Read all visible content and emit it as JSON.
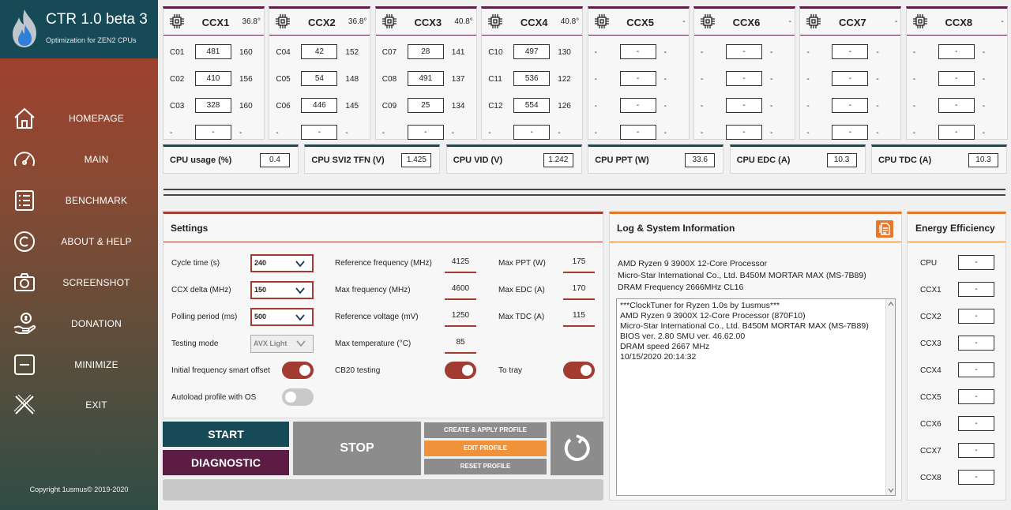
{
  "app": {
    "title": "CTR 1.0 beta 3",
    "subtitle": "Optimization for ZEN2 CPUs",
    "copyright": "Copyright 1usmus© 2019-2020"
  },
  "nav": [
    {
      "label": "HOMEPAGE",
      "icon": "home-icon"
    },
    {
      "label": "MAIN",
      "icon": "speedometer-icon"
    },
    {
      "label": "BENCHMARK",
      "icon": "checklist-icon"
    },
    {
      "label": "ABOUT & HELP",
      "icon": "copyright-icon"
    },
    {
      "label": "SCREENSHOT",
      "icon": "camera-icon"
    },
    {
      "label": "DONATION",
      "icon": "donation-hand-icon"
    },
    {
      "label": "MINIMIZE",
      "icon": "minimize-icon"
    },
    {
      "label": "EXIT",
      "icon": "exit-icon"
    }
  ],
  "ccx": [
    {
      "name": "CCX1",
      "temp": "36.8°",
      "cores": [
        {
          "name": "C01",
          "value": "481",
          "freq": "160"
        },
        {
          "name": "C02",
          "value": "410",
          "freq": "156"
        },
        {
          "name": "C03",
          "value": "328",
          "freq": "160"
        },
        {
          "name": "-",
          "value": "-",
          "freq": "-"
        }
      ]
    },
    {
      "name": "CCX2",
      "temp": "36.8°",
      "cores": [
        {
          "name": "C04",
          "value": "42",
          "freq": "152"
        },
        {
          "name": "C05",
          "value": "54",
          "freq": "148"
        },
        {
          "name": "C06",
          "value": "446",
          "freq": "145"
        },
        {
          "name": "-",
          "value": "-",
          "freq": "-"
        }
      ]
    },
    {
      "name": "CCX3",
      "temp": "40.8°",
      "cores": [
        {
          "name": "C07",
          "value": "28",
          "freq": "141"
        },
        {
          "name": "C08",
          "value": "491",
          "freq": "137"
        },
        {
          "name": "C09",
          "value": "25",
          "freq": "134"
        },
        {
          "name": "-",
          "value": "-",
          "freq": "-"
        }
      ]
    },
    {
      "name": "CCX4",
      "temp": "40.8°",
      "cores": [
        {
          "name": "C10",
          "value": "497",
          "freq": "130"
        },
        {
          "name": "C11",
          "value": "536",
          "freq": "122"
        },
        {
          "name": "C12",
          "value": "554",
          "freq": "126"
        },
        {
          "name": "-",
          "value": "-",
          "freq": "-"
        }
      ]
    },
    {
      "name": "CCX5",
      "temp": "-",
      "cores": [
        {
          "name": "-",
          "value": "-",
          "freq": "-"
        },
        {
          "name": "-",
          "value": "-",
          "freq": "-"
        },
        {
          "name": "-",
          "value": "-",
          "freq": "-"
        },
        {
          "name": "-",
          "value": "-",
          "freq": "-"
        }
      ]
    },
    {
      "name": "CCX6",
      "temp": "-",
      "cores": [
        {
          "name": "-",
          "value": "-",
          "freq": "-"
        },
        {
          "name": "-",
          "value": "-",
          "freq": "-"
        },
        {
          "name": "-",
          "value": "-",
          "freq": "-"
        },
        {
          "name": "-",
          "value": "-",
          "freq": "-"
        }
      ]
    },
    {
      "name": "CCX7",
      "temp": "-",
      "cores": [
        {
          "name": "-",
          "value": "-",
          "freq": "-"
        },
        {
          "name": "-",
          "value": "-",
          "freq": "-"
        },
        {
          "name": "-",
          "value": "-",
          "freq": "-"
        },
        {
          "name": "-",
          "value": "-",
          "freq": "-"
        }
      ]
    },
    {
      "name": "CCX8",
      "temp": "-",
      "cores": [
        {
          "name": "-",
          "value": "-",
          "freq": "-"
        },
        {
          "name": "-",
          "value": "-",
          "freq": "-"
        },
        {
          "name": "-",
          "value": "-",
          "freq": "-"
        },
        {
          "name": "-",
          "value": "-",
          "freq": "-"
        }
      ]
    }
  ],
  "metrics": [
    {
      "label": "CPU usage (%)",
      "value": "0.4"
    },
    {
      "label": "CPU SVI2 TFN (V)",
      "value": "1.425"
    },
    {
      "label": "CPU VID (V)",
      "value": "1.242"
    },
    {
      "label": "CPU PPT (W)",
      "value": "33.6"
    },
    {
      "label": "CPU EDC (A)",
      "value": "10.3"
    },
    {
      "label": "CPU TDC (A)",
      "value": "10.3"
    }
  ],
  "settings": {
    "title": "Settings",
    "cycle_time_label": "Cycle time (s)",
    "cycle_time": "240",
    "ccx_delta_label": "CCX delta (MHz)",
    "ccx_delta": "150",
    "polling_label": "Polling period (ms)",
    "polling": "500",
    "testing_mode_label": "Testing mode",
    "testing_mode": "AVX Light",
    "smart_offset_label": "Initial frequency smart offset",
    "autoload_label": "Autoload profile with OS",
    "ref_freq_label": "Reference frequency (MHz)",
    "ref_freq": "4125",
    "max_freq_label": "Max frequency (MHz)",
    "max_freq": "4600",
    "ref_volt_label": "Reference voltage (mV)",
    "ref_volt": "1250",
    "max_temp_label": "Max temperature (°C)",
    "max_temp": "85",
    "cb20_label": "CB20 testing",
    "max_ppt_label": "Max PPT (W)",
    "max_ppt": "175",
    "max_edc_label": "Max EDC (A)",
    "max_edc": "170",
    "max_tdc_label": "Max TDC (A)",
    "max_tdc": "115",
    "to_tray_label": "To tray"
  },
  "buttons": {
    "start": "START",
    "diagnostic": "DIAGNOSTIC",
    "stop": "STOP",
    "create_apply": "CREATE & APPLY PROFILE",
    "edit": "EDIT PROFILE",
    "reset": "RESET PROFILE"
  },
  "log": {
    "title": "Log & System Information",
    "cpu": "AMD Ryzen 9 3900X 12-Core Processor",
    "board": "Micro-Star International Co., Ltd. B450M MORTAR MAX (MS-7B89)",
    "dram": "DRAM Frequency 2666MHz CL16",
    "lines": [
      "***ClockTuner for Ryzen 1.0s by 1usmus***",
      "AMD Ryzen 9 3900X 12-Core Processor (870F10)",
      "Micro-Star International Co., Ltd. B450M MORTAR MAX (MS-7B89)",
      "BIOS ver. 2.80 SMU ver. 46.62.00",
      "DRAM speed 2667 MHz",
      "10/15/2020 20:14:32"
    ]
  },
  "energy": {
    "title": "Energy Efficiency",
    "rows": [
      {
        "name": "CPU",
        "value": "-"
      },
      {
        "name": "CCX1",
        "value": "-"
      },
      {
        "name": "CCX2",
        "value": "-"
      },
      {
        "name": "CCX3",
        "value": "-"
      },
      {
        "name": "CCX4",
        "value": "-"
      },
      {
        "name": "CCX5",
        "value": "-"
      },
      {
        "name": "CCX6",
        "value": "-"
      },
      {
        "name": "CCX7",
        "value": "-"
      },
      {
        "name": "CCX8",
        "value": "-"
      }
    ]
  },
  "colors": {
    "teal": "#174a57",
    "maroon": "#5d1c43",
    "red": "#a23c33",
    "orange": "#e07a2a"
  }
}
